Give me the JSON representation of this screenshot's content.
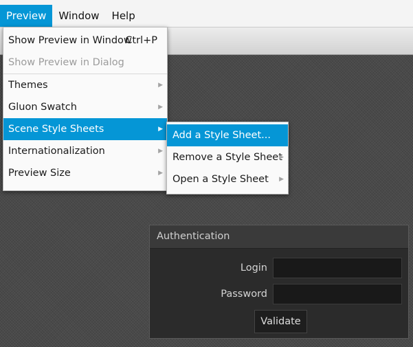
{
  "menubar": {
    "items": [
      {
        "label": "Preview"
      },
      {
        "label": "Window"
      },
      {
        "label": "Help"
      }
    ]
  },
  "preview_menu": {
    "items": [
      {
        "label": "Show Preview in Window",
        "accelerator": "Ctrl+P"
      },
      {
        "label": "Show Preview in Dialog"
      },
      {
        "label": "Themes"
      },
      {
        "label": "Gluon Swatch"
      },
      {
        "label": "Scene Style Sheets"
      },
      {
        "label": "Internationalization"
      },
      {
        "label": "Preview Size"
      }
    ]
  },
  "scene_submenu": {
    "items": [
      {
        "label": "Add a Style Sheet..."
      },
      {
        "label": "Remove a Style Sheet"
      },
      {
        "label": "Open a Style Sheet"
      }
    ]
  },
  "auth": {
    "title": "Authentication",
    "login_label": "Login",
    "password_label": "Password",
    "validate_label": "Validate"
  },
  "icons": {
    "submenu_arrow": "chevron-right-icon"
  },
  "colors": {
    "accent": "#0596d6",
    "menu_bg": "#fafafa",
    "panel_bg": "#2b2b2b",
    "canvas_bg": "#4a4a4a"
  }
}
